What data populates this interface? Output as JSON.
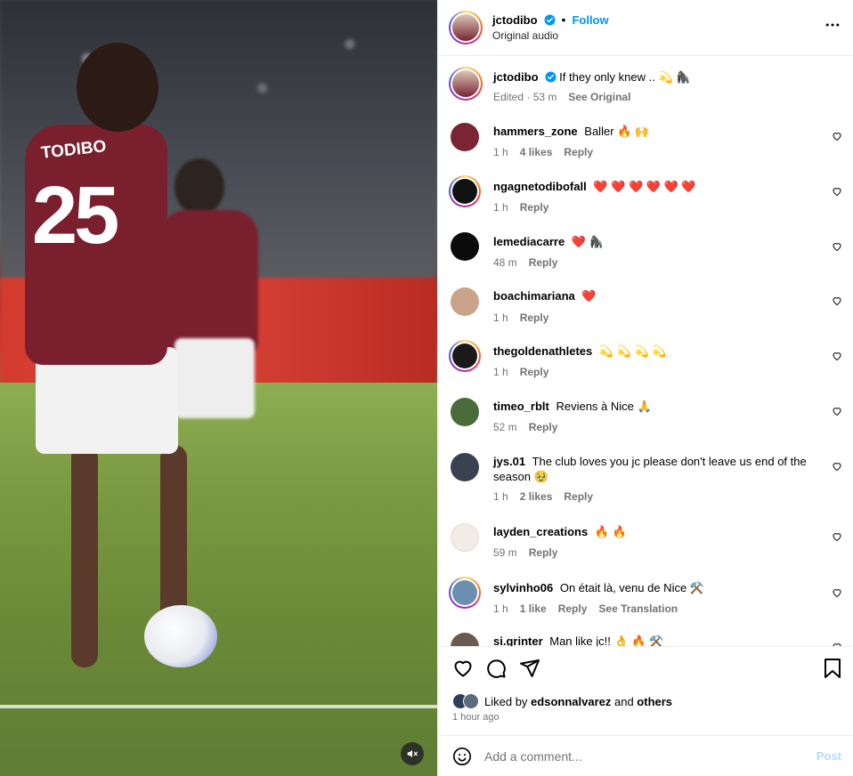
{
  "media": {
    "jersey_name": "TODIBO",
    "jersey_number": "25"
  },
  "post": {
    "username": "jctodibo",
    "follow_label": "Follow",
    "audio_label": "Original audio",
    "caption_text": "If they only knew .. 💫 🦍",
    "caption_edited": "Edited · 53 m",
    "see_original": "See Original"
  },
  "comments": [
    {
      "username": "hammers_zone",
      "text": "Baller 🔥 🙌",
      "time": "1 h",
      "likes": "4 likes",
      "reply": "Reply",
      "avatar_color": "#7a2434"
    },
    {
      "username": "ngagnetodibofall",
      "text": "❤️ ❤️ ❤️ ❤️ ❤️ ❤️",
      "time": "1 h",
      "likes": "",
      "reply": "Reply",
      "avatar_color": "#111111"
    },
    {
      "username": "lemediacarre",
      "text": "❤️ 🦍",
      "time": "48 m",
      "likes": "",
      "reply": "Reply",
      "avatar_color": "#0b0b0b"
    },
    {
      "username": "boachimariana",
      "text": "❤️",
      "time": "1 h",
      "likes": "",
      "reply": "Reply",
      "avatar_color": "#c9a48a"
    },
    {
      "username": "thegoldenathletes",
      "text": "💫 💫 💫 💫",
      "time": "1 h",
      "likes": "",
      "reply": "Reply",
      "avatar_color": "#1a1a1a"
    },
    {
      "username": "timeo_rblt",
      "text": "Reviens à Nice 🙏",
      "time": "52 m",
      "likes": "",
      "reply": "Reply",
      "avatar_color": "#4a6b3a"
    },
    {
      "username": "jys.01",
      "text": "The club loves you jc please don't leave us end of the season 🥹",
      "time": "1 h",
      "likes": "2 likes",
      "reply": "Reply",
      "avatar_color": "#3a4150"
    },
    {
      "username": "layden_creations",
      "text": "🔥 🔥",
      "time": "59 m",
      "likes": "",
      "reply": "Reply",
      "avatar_color": "#f1ede6"
    },
    {
      "username": "sylvinho06",
      "text": "On était là, venu de Nice ⚒️",
      "time": "1 h",
      "likes": "1 like",
      "reply": "Reply",
      "see_translation": "See Translation",
      "avatar_color": "#6a8fb0"
    },
    {
      "username": "si.grinter",
      "text": "Man like jc!! 👌 🔥 ⚒️",
      "time": "",
      "likes": "",
      "reply": "",
      "avatar_color": "#6b5a4e"
    }
  ],
  "likes": {
    "prefix": "Liked by ",
    "user": "edsonnalvarez",
    "middle": " and ",
    "others": "others",
    "time_ago": "1 hour ago"
  },
  "composer": {
    "placeholder": "Add a comment...",
    "post_label": "Post"
  },
  "colors": {
    "accent_blue": "#0095f6",
    "muted_text": "#737373",
    "post_disabled": "#b3dbff"
  }
}
